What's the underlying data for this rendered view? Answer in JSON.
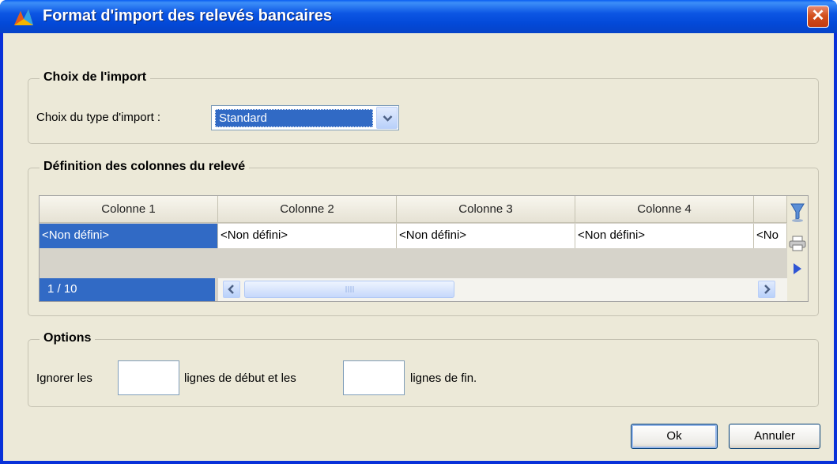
{
  "window": {
    "title": "Format d'import des relevés bancaires",
    "close_glyph": "✕",
    "app_icon": "app-logo-icon"
  },
  "import_choice": {
    "legend": "Choix de l'import",
    "type_label": "Choix du type d'import :",
    "type_value": "Standard"
  },
  "columns": {
    "legend": "Définition des colonnes du relevé",
    "headers": [
      "Colonne 1",
      "Colonne 2",
      "Colonne 3",
      "Colonne 4"
    ],
    "cells": [
      "<Non défini>",
      "<Non défini>",
      "<Non défini>",
      "<Non défini>",
      "<No"
    ],
    "counter": "1 / 10",
    "tools": [
      "filter-icon",
      "print-icon",
      "play-arrow-icon"
    ]
  },
  "options": {
    "legend": "Options",
    "text_before": "Ignorer les",
    "start_value": "",
    "text_middle": "lignes de début et les",
    "end_value": "",
    "text_after": "lignes de fin."
  },
  "buttons": {
    "ok": "Ok",
    "cancel": "Annuler"
  }
}
